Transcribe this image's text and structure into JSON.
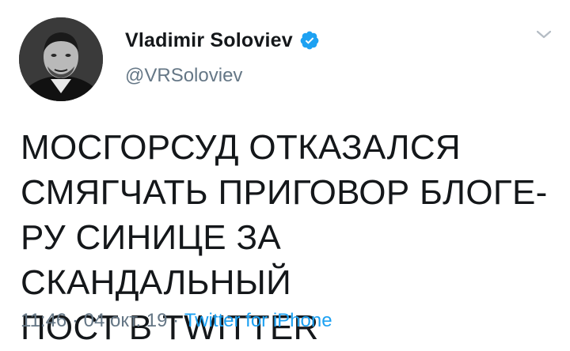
{
  "author": {
    "display_name": "Vladimir Soloviev",
    "handle": "@VRSoloviev",
    "verified": true,
    "avatar_icon": "profile-photo"
  },
  "tweet": {
    "text": "МОСГОРСУД ОТКАЗАЛСЯ\nСМЯГЧАТЬ ПРИГОВОР БЛОГЕ-\nРУ СИНИЦЕ ЗА СКАНДАЛЬНЫЙ\nПОСТ В TWITTER",
    "time": "11:46",
    "separator": "·",
    "date": "04 окт. 19",
    "source": "Twitter for iPhone"
  },
  "icons": {
    "verified": "verified-badge-icon",
    "menu": "chevron-down-icon"
  },
  "colors": {
    "text": "#14171a",
    "secondary": "#657786",
    "accent": "#1da1f2"
  }
}
